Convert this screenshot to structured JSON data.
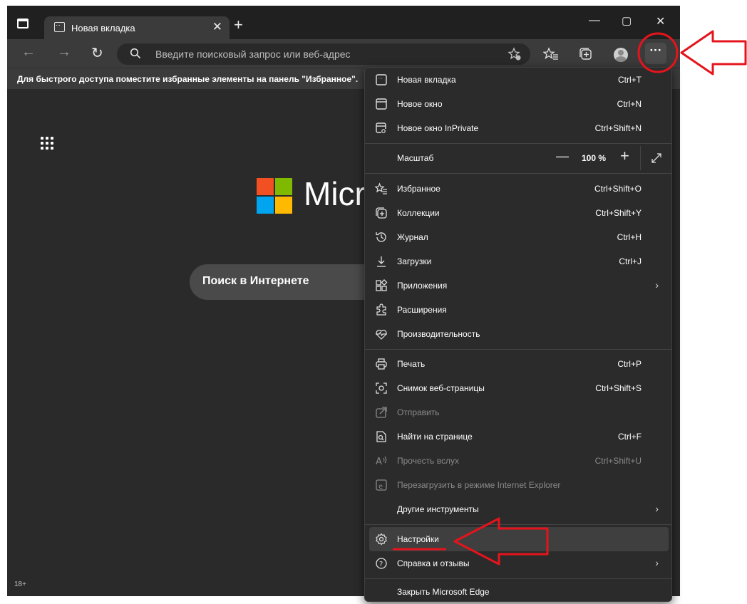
{
  "tab": {
    "title": "Новая вкладка"
  },
  "window_controls": {
    "minimize": "—",
    "maximize": "▢",
    "close": "✕"
  },
  "address_bar": {
    "placeholder": "Введите поисковый запрос или веб-адрес"
  },
  "favorites_bar": {
    "hint": "Для быстрого доступа поместите избранные элементы на панель \"Избранное\"."
  },
  "page": {
    "logo_text": "Micro",
    "search_label": "Поиск в Интернете",
    "age_badge": "18+"
  },
  "menu": {
    "zoom": {
      "label": "Масштаб",
      "value": "100 %",
      "minus": "—",
      "plus": "+"
    },
    "items": [
      {
        "label": "Новая вкладка",
        "shortcut": "Ctrl+T",
        "icon": "new-tab-icon"
      },
      {
        "label": "Новое окно",
        "shortcut": "Ctrl+N",
        "icon": "new-window-icon"
      },
      {
        "label": "Новое окно InPrivate",
        "shortcut": "Ctrl+Shift+N",
        "icon": "inprivate-icon"
      },
      {
        "label": "Избранное",
        "shortcut": "Ctrl+Shift+O",
        "icon": "favorites-icon"
      },
      {
        "label": "Коллекции",
        "shortcut": "Ctrl+Shift+Y",
        "icon": "collections-icon"
      },
      {
        "label": "Журнал",
        "shortcut": "Ctrl+H",
        "icon": "history-icon"
      },
      {
        "label": "Загрузки",
        "shortcut": "Ctrl+J",
        "icon": "downloads-icon"
      },
      {
        "label": "Приложения",
        "shortcut": "",
        "icon": "apps-icon"
      },
      {
        "label": "Расширения",
        "shortcut": "",
        "icon": "extensions-icon"
      },
      {
        "label": "Производительность",
        "shortcut": "",
        "icon": "performance-icon"
      },
      {
        "label": "Печать",
        "shortcut": "Ctrl+P",
        "icon": "print-icon"
      },
      {
        "label": "Снимок веб-страницы",
        "shortcut": "Ctrl+Shift+S",
        "icon": "screenshot-icon"
      },
      {
        "label": "Отправить",
        "shortcut": "",
        "icon": "share-icon"
      },
      {
        "label": "Найти на странице",
        "shortcut": "Ctrl+F",
        "icon": "find-icon"
      },
      {
        "label": "Прочесть вслух",
        "shortcut": "Ctrl+Shift+U",
        "icon": "read-aloud-icon"
      },
      {
        "label": "Перезагрузить в режиме Internet Explorer",
        "shortcut": "",
        "icon": "ie-mode-icon"
      },
      {
        "label": "Другие инструменты",
        "shortcut": "",
        "icon": ""
      },
      {
        "label": "Настройки",
        "shortcut": "",
        "icon": "settings-icon"
      },
      {
        "label": "Справка и отзывы",
        "shortcut": "",
        "icon": "help-icon"
      },
      {
        "label": "Закрыть Microsoft Edge",
        "shortcut": "",
        "icon": ""
      }
    ]
  },
  "colors": {
    "accent_red": "#e4141c",
    "menu_bg": "#2b2b2b",
    "page_bg": "#2a2a2a"
  }
}
